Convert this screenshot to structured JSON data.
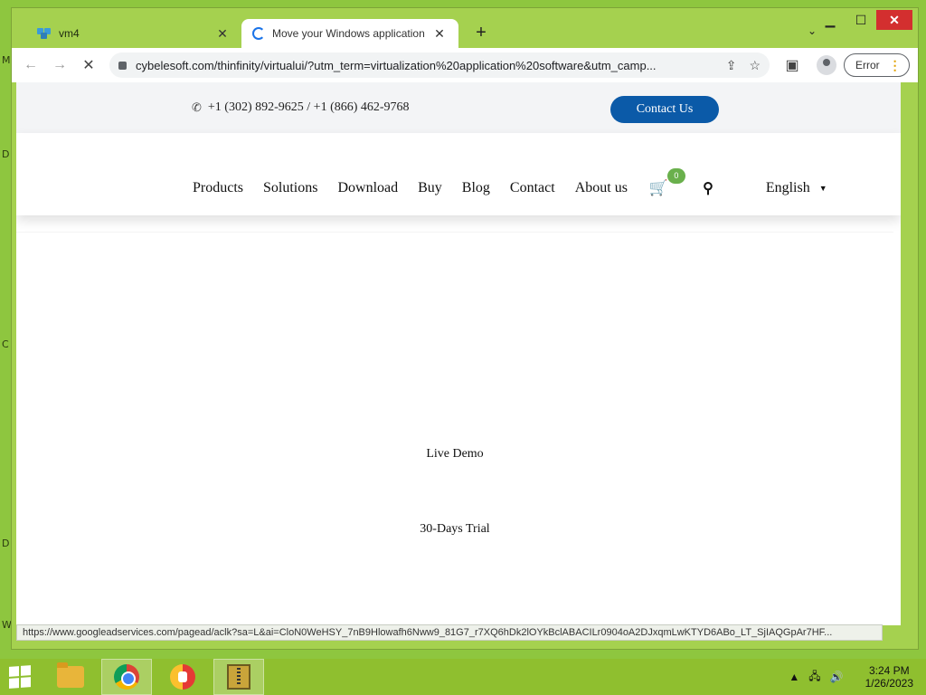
{
  "desktop": {
    "edge_glyphs": [
      "M",
      "D",
      "C",
      "D",
      "W"
    ]
  },
  "browser": {
    "tabs": [
      {
        "title": "vm4",
        "icon": "vm-icon",
        "active": false
      },
      {
        "title": "Move your Windows application",
        "icon": "loading-spinner-icon",
        "active": true
      }
    ],
    "new_tab_label": "+",
    "tab_close_glyph": "✕",
    "tab_search_glyph": "⌄",
    "window_controls": {
      "minimize": "▁",
      "maximize": "☐",
      "close": "✕"
    },
    "url": "cybelesoft.com/thinfinity/virtualui/?utm_term=virtualization%20application%20software&utm_camp...",
    "error_label": "Error",
    "status_url": "https://www.googleadservices.com/pagead/aclk?sa=L&ai=CloN0WeHSY_7nB9Hlowafh6Nww9_81G7_r7XQ6hDk2lOYkBclABACILr0904oA2DJxqmLwKTYD6ABo_LT_SjIAQGpAr7HF..."
  },
  "page": {
    "phone_text": "+1 (302) 892-9625 / +1 (866) 462-9768",
    "contact_button": "Contact Us",
    "nav": {
      "items": [
        "Products",
        "Solutions",
        "Download",
        "Buy",
        "Blog",
        "Contact",
        "About us"
      ],
      "cart_count": "0",
      "language": "English"
    },
    "live_demo": "Live Demo",
    "trial": "30-Days Trial"
  },
  "taskbar": {
    "apps": [
      "file-explorer",
      "chrome",
      "vpn",
      "archive"
    ],
    "time": "3:24 PM",
    "date": "1/26/2023"
  },
  "colors": {
    "desktop": "#8ec63f",
    "window_frame": "#a5d14f",
    "contact_button": "#0b5aa8",
    "cart_badge": "#6ab04c",
    "close_button": "#d32f2f"
  }
}
